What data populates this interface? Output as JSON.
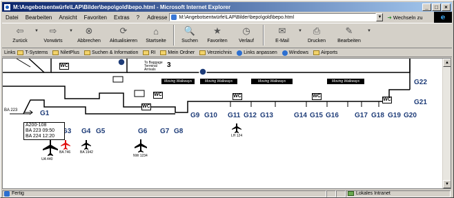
{
  "window": {
    "title": "M:\\Angebotsentwürfe\\LAP\\Bilder\\bepo\\gold\\bepo.html - Microsoft Internet Explorer",
    "controls": [
      "_",
      "□",
      "×"
    ]
  },
  "menubar": {
    "items": [
      "Datei",
      "Bearbeiten",
      "Ansicht",
      "Favoriten",
      "Extras",
      "?"
    ],
    "address_label": "Adresse",
    "address_value": "M:\\Angebotsentwürfe\\LAP\\Bilder\\bepo\\gold\\bepo.html",
    "go_label": "Wechseln zu"
  },
  "toolbar": {
    "buttons": [
      {
        "label": "Zurück",
        "icon": "back-arrow-icon",
        "glyph": "⇦"
      },
      {
        "label": "Vorwärts",
        "icon": "forward-arrow-icon",
        "glyph": "⇨"
      },
      {
        "label": "Abbrechen",
        "icon": "stop-icon",
        "glyph": "⊗"
      },
      {
        "label": "Aktualisieren",
        "icon": "refresh-icon",
        "glyph": "⟳"
      },
      {
        "label": "Startseite",
        "icon": "home-icon",
        "glyph": "⌂"
      },
      {
        "label": "Suchen",
        "icon": "search-icon",
        "glyph": "🔍"
      },
      {
        "label": "Favoriten",
        "icon": "favorites-icon",
        "glyph": "★"
      },
      {
        "label": "Verlauf",
        "icon": "history-icon",
        "glyph": "◷"
      },
      {
        "label": "E-Mail",
        "icon": "mail-icon",
        "glyph": "✉"
      },
      {
        "label": "Drucken",
        "icon": "print-icon",
        "glyph": "⎙"
      },
      {
        "label": "Bearbeiten",
        "icon": "edit-icon",
        "glyph": "✎"
      }
    ]
  },
  "links": {
    "label": "Links",
    "items": [
      {
        "label": "T-Systems",
        "type": "folder"
      },
      {
        "label": "NiletPlus",
        "type": "folder"
      },
      {
        "label": "Suchen & Information",
        "type": "folder"
      },
      {
        "label": "RI",
        "type": "folder"
      },
      {
        "label": "Mein Ordner",
        "type": "folder"
      },
      {
        "label": "Verzeichnis",
        "type": "folder"
      },
      {
        "label": "Links anpassen",
        "type": "globe"
      },
      {
        "label": "Windows",
        "type": "globe"
      },
      {
        "label": "Airports",
        "type": "folder"
      }
    ]
  },
  "map": {
    "gates_left": [
      "G1",
      "G3",
      "G4",
      "G5",
      "G6",
      "G7",
      "G8"
    ],
    "gates_middle": [
      "G9",
      "G10",
      "G11",
      "G12",
      "G13",
      "G14",
      "G15",
      "G16",
      "G17",
      "G18",
      "G19",
      "G20"
    ],
    "gates_right": [
      "G22",
      "G21"
    ],
    "walkway_label": "Moving Walkways",
    "tooltip_lines": [
      "A200-108",
      "BA 223 09:50",
      "BA 224 12:20"
    ],
    "flight_label_ba223": "BA 223",
    "planes": [
      {
        "label": "UA 440",
        "color": "#000000"
      },
      {
        "label": "BA 746",
        "color": "#e01010"
      },
      {
        "label": "BA 1942",
        "color": "#000000"
      },
      {
        "label": "NW 1234",
        "color": "#000000"
      },
      {
        "label": "LH 124",
        "color": "#000000"
      }
    ],
    "wc_label": "WC",
    "terminal_number": "3",
    "info_sign_lines": [
      "To Baggage",
      "Terminal",
      "Arrivals"
    ]
  },
  "statusbar": {
    "status_text": "Fertig",
    "zone_text": "Lokales Intranet"
  },
  "colors": {
    "gate_text": "#1e3c78",
    "title_gradient_start": "#0a246a",
    "title_gradient_end": "#a6caf0",
    "plane_highlight": "#e01010"
  }
}
